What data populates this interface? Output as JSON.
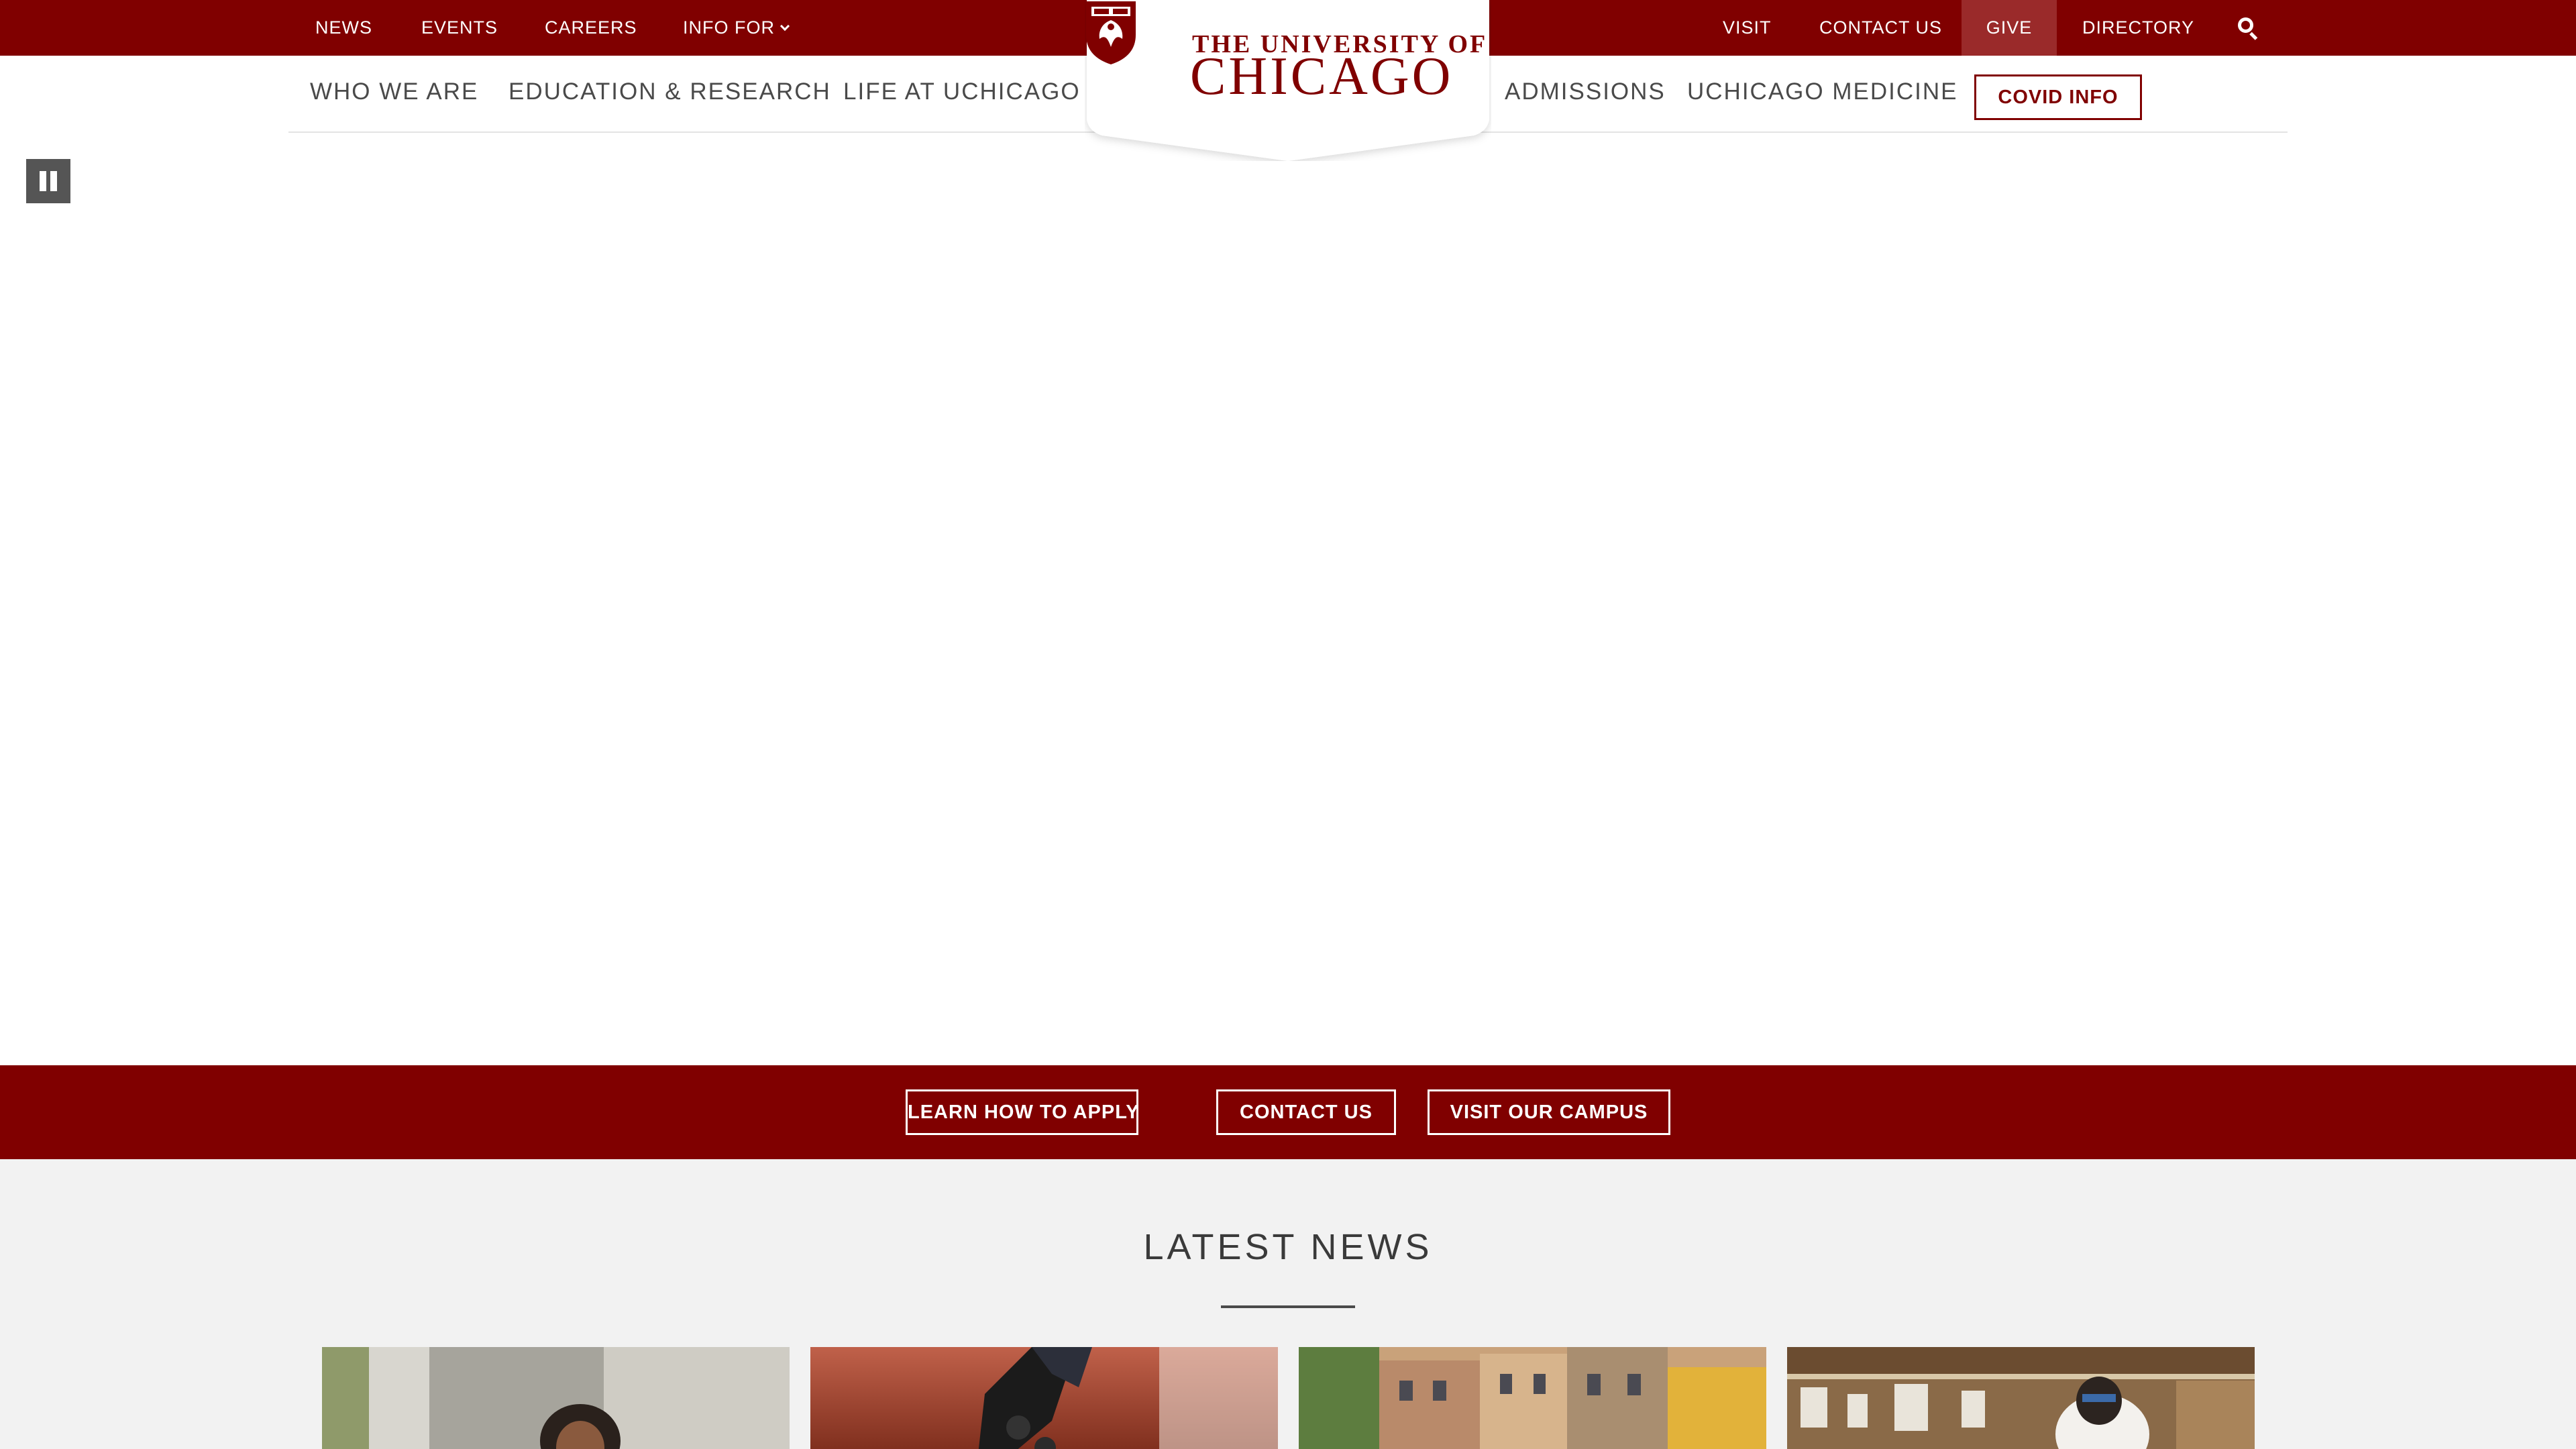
{
  "utility_nav": {
    "left": [
      "NEWS",
      "EVENTS",
      "CAREERS",
      "INFO FOR"
    ],
    "right": [
      "VISIT",
      "CONTACT US",
      "GIVE",
      "DIRECTORY"
    ],
    "search_icon": "search-icon"
  },
  "logo": {
    "line1": "THE UNIVERSITY OF",
    "line2": "CHICAGO"
  },
  "main_nav": {
    "items": [
      "WHO WE ARE",
      "EDUCATION & RESEARCH",
      "LIFE AT UCHICAGO",
      "ADMISSIONS",
      "UCHICAGO MEDICINE"
    ],
    "covid": "COVID INFO"
  },
  "hero": {
    "pause_icon": "pause-icon"
  },
  "cta": {
    "buttons": [
      "LEARN HOW TO APPLY",
      "CONTACT US",
      "VISIT OUR CAMPUS"
    ]
  },
  "news": {
    "title": "LATEST NEWS"
  },
  "colors": {
    "brand": "#800000",
    "give_highlight": "#9a2a2a",
    "news_bg": "#f2f2f2"
  }
}
